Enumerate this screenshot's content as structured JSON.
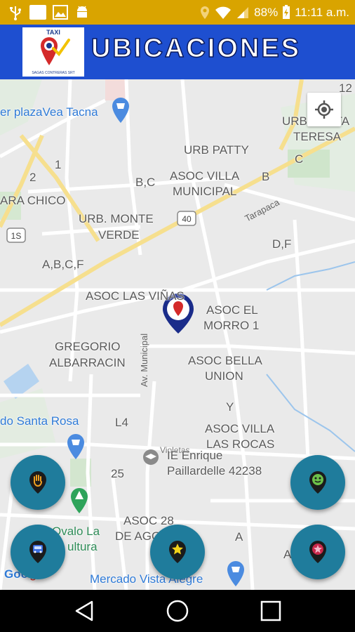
{
  "status_bar": {
    "battery": "88%",
    "time": "11:11 a.m.",
    "background": "#d9a400"
  },
  "app_bar": {
    "title": "UBICACIONES",
    "logo_text_top": "TAXI",
    "logo_text_bottom": "SAGAS CONTRERAS SRT",
    "background": "#1e4fd0"
  },
  "map": {
    "labels": [
      {
        "text": "er plazaVea Tacna",
        "style": "blue"
      },
      {
        "text": "URB SANTA",
        "style": "grey"
      },
      {
        "text": "TERESA",
        "style": "grey"
      },
      {
        "text": "URB PATTY",
        "style": "grey"
      },
      {
        "text": "C",
        "style": "grey"
      },
      {
        "text": "B",
        "style": "grey"
      },
      {
        "text": "ASOC VILLA",
        "style": "grey"
      },
      {
        "text": "MUNICIPAL",
        "style": "grey"
      },
      {
        "text": "B,C",
        "style": "grey"
      },
      {
        "text": "2",
        "style": "grey"
      },
      {
        "text": "1",
        "style": "grey"
      },
      {
        "text": "ARA CHICO",
        "style": "grey"
      },
      {
        "text": "URB. MONTE",
        "style": "grey"
      },
      {
        "text": "VERDE",
        "style": "grey"
      },
      {
        "text": "D,F",
        "style": "grey"
      },
      {
        "text": "A,B,C,F",
        "style": "grey"
      },
      {
        "text": "ASOC LAS VIÑAS",
        "style": "grey"
      },
      {
        "text": "ASOC EL",
        "style": "grey"
      },
      {
        "text": "MORRO 1",
        "style": "grey"
      },
      {
        "text": "GREGORIO",
        "style": "grey"
      },
      {
        "text": "ALBARRACIN",
        "style": "grey"
      },
      {
        "text": "ASOC BELLA",
        "style": "grey"
      },
      {
        "text": "UNION",
        "style": "grey"
      },
      {
        "text": "Y",
        "style": "grey"
      },
      {
        "text": "do Santa Rosa",
        "style": "blue"
      },
      {
        "text": "L4",
        "style": "grey"
      },
      {
        "text": "ASOC VILLA",
        "style": "grey"
      },
      {
        "text": "LAS ROCAS",
        "style": "grey"
      },
      {
        "text": "IE Enrique",
        "style": "grey"
      },
      {
        "text": "Paillardelle 42238",
        "style": "grey"
      },
      {
        "text": "25",
        "style": "grey"
      },
      {
        "text": "Ovalo La",
        "style": "green"
      },
      {
        "text": "ultura",
        "style": "green"
      },
      {
        "text": "ASOC 28",
        "style": "grey"
      },
      {
        "text": "DE AGOS",
        "style": "grey"
      },
      {
        "text": "A",
        "style": "grey"
      },
      {
        "text": "Mercado Vista Alegre",
        "style": "blue"
      },
      {
        "text": "Goo",
        "style": "blue"
      },
      {
        "text": "gle",
        "style": "red"
      },
      {
        "text": "12",
        "style": "grey"
      },
      {
        "text": "A",
        "style": "grey"
      },
      {
        "text": "B",
        "style": "grey"
      }
    ],
    "road_labels": {
      "tarapaca": "Tarapaca",
      "av_municipal": "Av. Municipal",
      "route_40": "40",
      "route_1s": "1S",
      "violetas": "Violetas"
    }
  },
  "fab_buttons": {
    "hand": "hand-pin",
    "green": "green-face-pin",
    "bus": "bus-pin",
    "star": "star-pin",
    "shield": "badge-pin",
    "color": "#1f7c9c"
  }
}
